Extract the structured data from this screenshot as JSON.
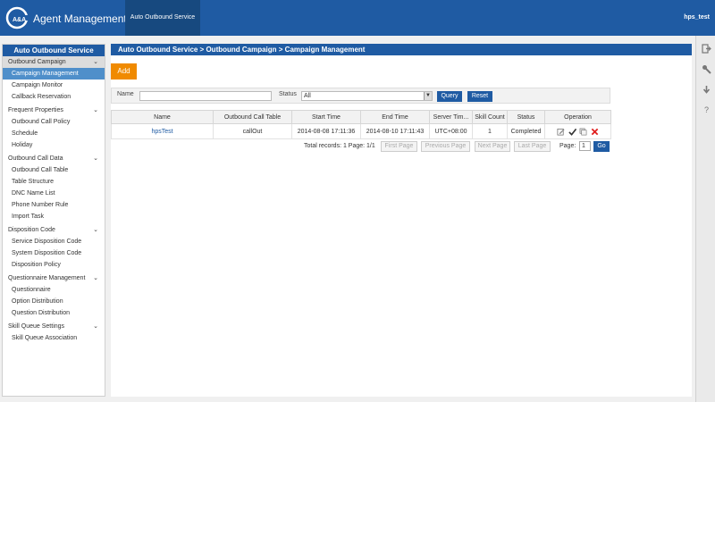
{
  "header": {
    "logo_text": "A&A",
    "app_title": "Agent Management",
    "active_tab": "Auto Outbound Service",
    "user": "hps_test"
  },
  "sidebar": {
    "title": "Auto Outbound Service",
    "groups": [
      {
        "label": "Outbound Campaign",
        "items": [
          "Campaign Management",
          "Campaign Monitor",
          "Callback Reservation"
        ]
      },
      {
        "label": "Frequent Properties",
        "items": [
          "Outbound Call Policy",
          "Schedule",
          "Holiday"
        ]
      },
      {
        "label": "Outbound Call Data",
        "items": [
          "Outbound Call Table",
          "Table Structure",
          "DNC Name List",
          "Phone Number Rule",
          "Import Task"
        ]
      },
      {
        "label": "Disposition Code",
        "items": [
          "Service Disposition Code",
          "System Disposition Code",
          "Disposition Policy"
        ]
      },
      {
        "label": "Questionnaire Management",
        "items": [
          "Questionnaire",
          "Option Distribution",
          "Question Distribution"
        ]
      },
      {
        "label": "Skill Queue Settings",
        "items": [
          "Skill Queue Association"
        ]
      }
    ],
    "selected_item": "Campaign Management"
  },
  "main": {
    "breadcrumb": "Auto Outbound Service > Outbound Campaign > Campaign Management",
    "add_label": "Add",
    "search": {
      "name_label": "Name",
      "name_value": "",
      "status_label": "Status",
      "status_value": "All",
      "query_label": "Query",
      "reset_label": "Reset"
    },
    "table": {
      "columns": [
        "Name",
        "Outbound Call Table",
        "Start Time",
        "End Time",
        "Server Tim...",
        "Skill Count",
        "Status",
        "Operation"
      ],
      "rows": [
        {
          "name": "hpsTest",
          "table": "callOut",
          "start": "2014-08-08 17:11:36",
          "end": "2014-08-10 17:11:43",
          "server_time": "UTC+08:00",
          "skill_count": "1",
          "status": "Completed"
        }
      ]
    },
    "pager": {
      "summary": "Total records: 1 Page: 1/1",
      "first": "First Page",
      "previous": "Previous Page",
      "next": "Next Page",
      "last": "Last Page",
      "page_label": "Page:",
      "page_value": "1",
      "go_label": "Go"
    }
  },
  "colors": {
    "header_blue": "#1f5ba3",
    "selected_blue": "#4f8fca",
    "add_orange": "#f08a00"
  },
  "rail_icons": [
    "exit-icon",
    "wrench-icon",
    "download-icon",
    "help-icon"
  ]
}
